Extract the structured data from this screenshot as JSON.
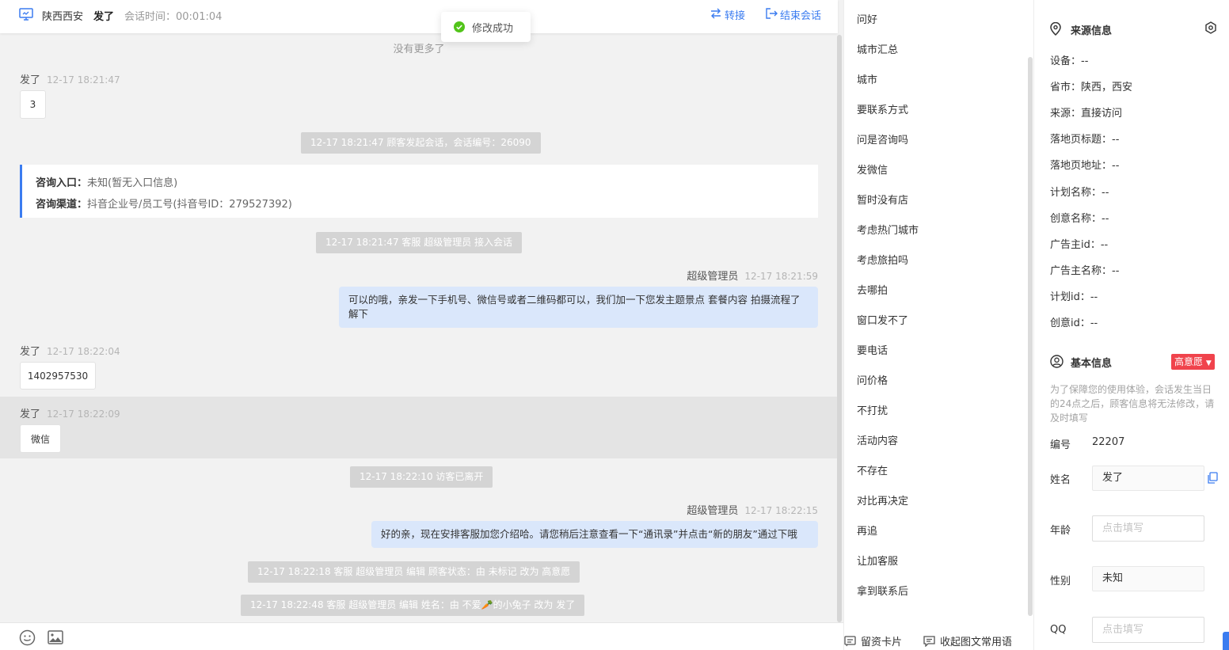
{
  "header": {
    "location": "陕西西安",
    "visitor_name": "发了",
    "duration": "会话时间：00:01:04",
    "transfer_label": "转接",
    "end_label": "结束会话"
  },
  "toast": {
    "text": "修改成功"
  },
  "messages": {
    "no_more": "没有更多了",
    "m1": {
      "name": "发了",
      "time": "12-17 18:21:47",
      "text": "3"
    },
    "sys1": "12-17 18:21:47 顾客发起会话，会话编号：26090",
    "info_card": {
      "entry_label": "咨询入口：",
      "entry_value": "未知(暂无入口信息)",
      "channel_label": "咨询渠道：",
      "channel_value": "抖音企业号/员工号(抖音号ID：279527392)"
    },
    "sys2": "12-17 18:21:47 客服 超级管理员 接入会话",
    "m2": {
      "name": "超级管理员",
      "time": "12-17 18:21:59",
      "text": "可以的哦，亲发一下手机号、微信号或者二维码都可以，我们加一下您发主题景点 套餐内容 拍摄流程了解下"
    },
    "m3": {
      "name": "发了",
      "time": "12-17 18:22:04",
      "text": "1402957530"
    },
    "m4": {
      "name": "发了",
      "time": "12-17 18:22:09",
      "text": "微信"
    },
    "sys3": "12-17 18:22:10 访客已离开",
    "m5": {
      "name": "超级管理员",
      "time": "12-17 18:22:15",
      "text": "好的亲，现在安排客服加您介绍哈。请您稍后注意查看一下“通讯录”并点击“新的朋友”通过下哦"
    },
    "sys4": "12-17 18:22:18 客服 超级管理员 编辑 顾客状态：由 未标记 改为 高意愿",
    "sys5": "12-17 18:22:48 客服 超级管理员 编辑 姓名：由 不爱🥕的小兔子 改为 发了"
  },
  "phrases": [
    "问好",
    "城市汇总",
    "城市",
    "要联系方式",
    "问是咨询吗",
    "发微信",
    "暂时没有店",
    "考虑热门城市",
    "考虑旅拍吗",
    "去哪拍",
    "窗口发不了",
    "要电话",
    "问价格",
    "不打扰",
    "活动内容",
    "不存在",
    "对比再决定",
    "再追",
    "让加客服",
    "拿到联系后"
  ],
  "footer": {
    "card_label": "留资卡片",
    "collapse_label": "收起图文常用语"
  },
  "source_info": {
    "title": "来源信息",
    "items": [
      "设备：--",
      "省市：陕西，西安",
      "来源：直接访问",
      "落地页标题：--",
      "落地页地址：--",
      "计划名称：--",
      "创意名称：--",
      "广告主id：--",
      "广告主名称：--",
      "计划id：--",
      "创意id：--"
    ]
  },
  "basic_info": {
    "title": "基本信息",
    "intent_badge": "高意愿",
    "notice": "为了保障您的使用体验，会话发生当日的24点之后，顾客信息将无法修改，请及时填写",
    "id_label": "编号",
    "id_value": "22207",
    "name_label": "姓名",
    "name_value": "发了",
    "age_label": "年龄",
    "age_placeholder": "点击填写",
    "gender_label": "性别",
    "gender_value": "未知",
    "qq_label": "QQ",
    "qq_placeholder": "点击填写"
  },
  "colors": {
    "accent": "#3b7cf0",
    "agent_bubble": "#dae7fb",
    "system_pill": "#d4d4d4",
    "intent_badge": "#f0434c",
    "success": "#52c41a"
  },
  "icons": [
    "monitor-icon",
    "transfer-icon",
    "logout-icon",
    "check-circle-icon",
    "emoji-icon",
    "image-icon",
    "card-icon",
    "message-icon",
    "location-pin-icon",
    "settings-icon",
    "user-circle-icon",
    "caret-down-icon",
    "copy-icon"
  ]
}
